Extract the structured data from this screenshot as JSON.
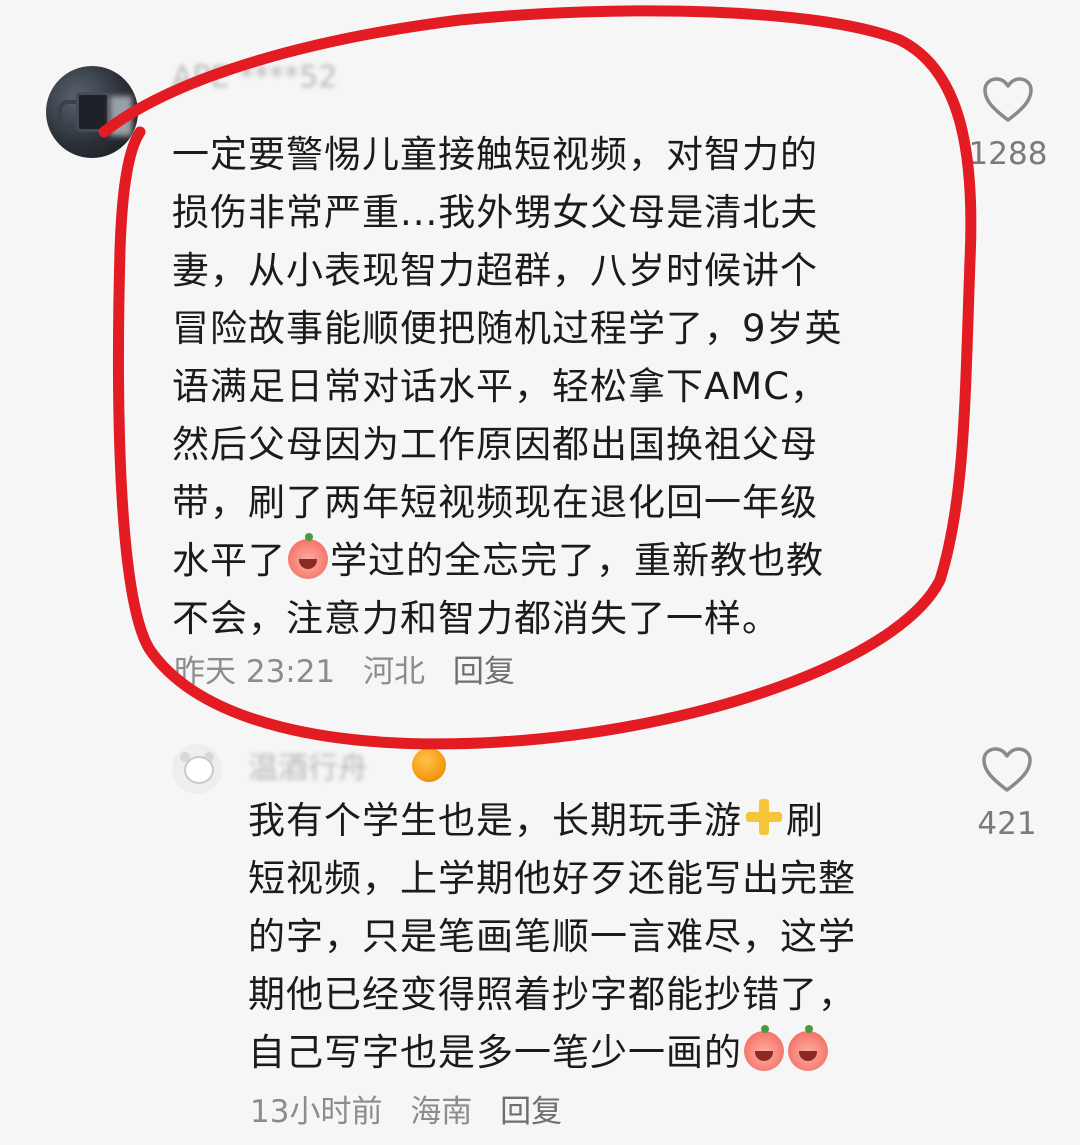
{
  "comments": [
    {
      "username": "APE ****52",
      "lines": [
        "一定要警惕儿童接触短视频，对智力的",
        "损伤非常严重...我外甥女父母是清北夫",
        "妻，从小表现智力超群，八岁时候讲个",
        "冒险故事能顺便把随机过程学了，9岁英",
        "语满足日常对话水平，轻松拿下AMC，",
        "然后父母因为工作原因都出国换祖父母",
        "带，刷了两年短视频现在退化回一年级",
        "水平了",
        "学过的全忘完了，重新教也教",
        "不会，注意力和智力都消失了一样。"
      ],
      "time": "昨天 23:21",
      "location": "河北",
      "reply_label": "回复",
      "likes": "1288",
      "icons": [
        "avatar",
        "heart-outline-icon",
        "crying-emoji-icon"
      ]
    },
    {
      "username": "温酒行舟",
      "lines": [
        "我有个学生也是，长期玩手游",
        "刷",
        "短视频，上学期他好歹还能写出完整",
        "的字，只是笔画笔顺一言难尽，这学",
        "期他已经变得照着抄字都能抄错了，",
        "自己写字也是多一笔少一画的"
      ],
      "time": "13小时前",
      "location": "海南",
      "reply_label": "回复",
      "likes": "421",
      "icons": [
        "avatar",
        "orange-badge-icon",
        "heart-outline-icon",
        "plus-emoji-icon",
        "crying-emoji-icon"
      ]
    }
  ],
  "colors": {
    "background": "#f6f6f6",
    "annotation": "#e31b23",
    "meta": "#8c8c8c"
  }
}
